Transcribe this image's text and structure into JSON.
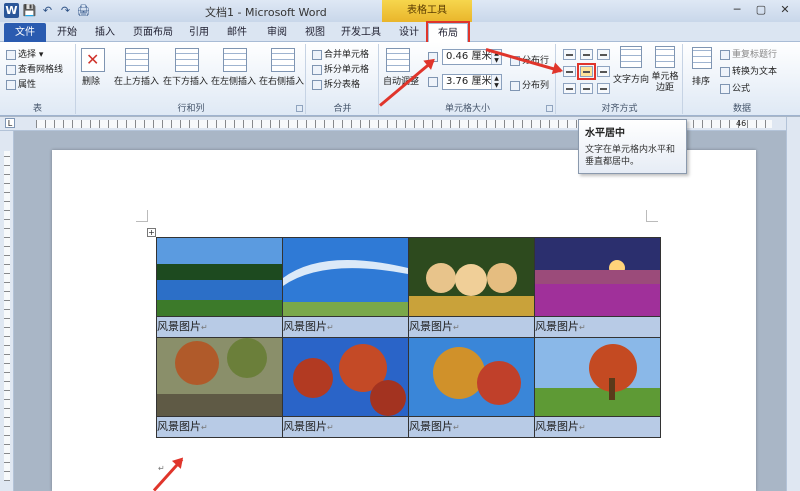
{
  "title_bar": {
    "title": "文档1 - Microsoft Word",
    "context_group": "表格工具",
    "qat": {
      "logo": "W",
      "save": "💾",
      "undo": "↶",
      "redo": "↷",
      "print": "🖨"
    }
  },
  "tabs": [
    "文件",
    "开始",
    "插入",
    "页面布局",
    "引用",
    "邮件",
    "审阅",
    "视图",
    "开发工具",
    "设计",
    "布局"
  ],
  "ribbon": {
    "table_group": {
      "label": "表",
      "select": "选择 ▾",
      "gridlines": "查看网格线",
      "properties": "属性"
    },
    "rows_cols_group": {
      "label": "行和列",
      "delete": "删除",
      "insert_above": "在上方插入",
      "insert_below": "在下方插入",
      "insert_left": "在左侧插入",
      "insert_right": "在右侧插入"
    },
    "merge_group": {
      "label": "合并",
      "merge_cells": "合并单元格",
      "split_cells": "拆分单元格",
      "split_table": "拆分表格"
    },
    "cell_size_group": {
      "label": "单元格大小",
      "autofit": "自动调整",
      "height_value": "0.46 厘米",
      "width_value": "3.76 厘米",
      "distribute_rows": "分布行",
      "distribute_cols": "分布列"
    },
    "alignment_group": {
      "label": "对齐方式",
      "text_direction": "文字方向",
      "cell_margins": "单元格边距"
    },
    "data_group": {
      "label": "数据",
      "sort": "排序",
      "repeat_header": "重复标题行",
      "convert_text": "转换为文本",
      "formula": "公式"
    }
  },
  "ruler": {
    "left_mark": "L",
    "right_mark": "46"
  },
  "tooltip": {
    "title": "水平居中",
    "body": "文字在单元格内水平和垂直都居中。"
  },
  "table": {
    "caption": "风景图片",
    "rows": [
      {
        "images": [
          "lake-forest",
          "blue-sky",
          "three-puppies",
          "sunset-flowers"
        ]
      },
      {
        "images": [
          "autumn-park",
          "red-leaves",
          "autumn-tree",
          "tree-field"
        ]
      }
    ]
  },
  "colors": {
    "accent": "#2a5bb0",
    "highlight": "#e0352b",
    "caption_bg": "#b8cbe6"
  }
}
